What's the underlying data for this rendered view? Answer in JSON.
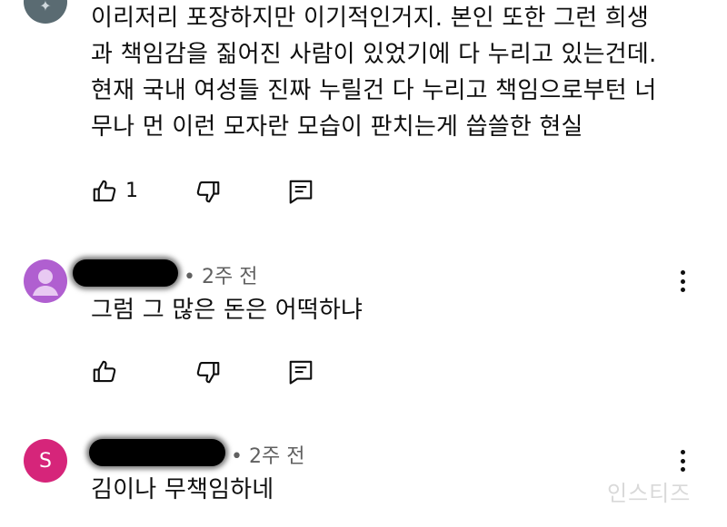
{
  "comments": [
    {
      "lines": [
        "이리저리 포장하지만 이기적인거지. 본인 또한 그런 희생",
        "과 책임감을 짊어진 사람이 있었기에 다 누리고 있는건데.",
        "현재 국내 여성들 진짜 누릴건 다 누리고 책임으로부턴 너",
        "무나 먼 이런 모자란 모습이 판치는게 씁쓸한 현실"
      ],
      "like_count": "1"
    },
    {
      "time": "• 2주 전",
      "text": "그럼 그 많은 돈은 어떡하냐",
      "avatar_color": "#b05fd0"
    },
    {
      "time": "• 2주 전",
      "text": "김이나 무책임하네",
      "avatar_letter": "S",
      "avatar_color": "#d6257a"
    }
  ],
  "watermark": "인스티즈",
  "icons": [
    "like-icon",
    "dislike-icon",
    "reply-icon",
    "more-options-icon"
  ]
}
